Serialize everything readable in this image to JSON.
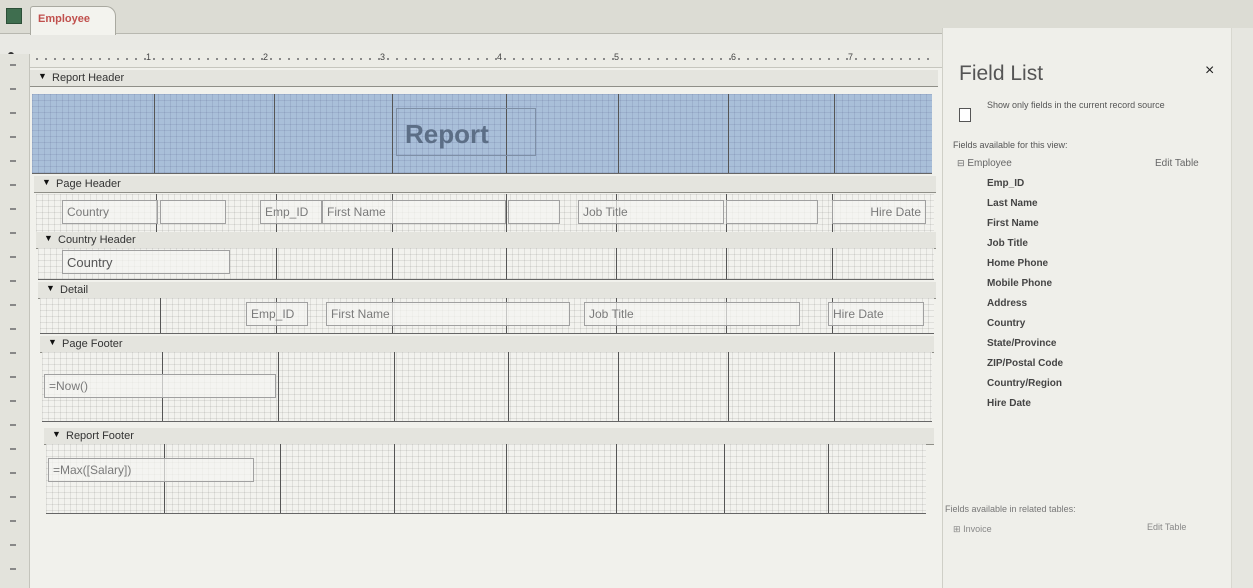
{
  "tab": {
    "label": "Employee"
  },
  "ruler": {
    "numbers": [
      "1",
      "2",
      "3",
      "4",
      "5",
      "6",
      "7"
    ]
  },
  "sections": {
    "report_header": "Report Header",
    "page_header": "Page Header",
    "country_header": "Country Header",
    "detail": "Detail",
    "page_footer": "Page Footer",
    "report_footer": "Report Footer"
  },
  "report_header": {
    "title": "Report"
  },
  "page_header": {
    "country": "Country",
    "emp_id": "Emp_ID",
    "first_name": "First Name",
    "job_title": "Job Title",
    "hire_date": "Hire Date"
  },
  "country_header": {
    "country": "Country"
  },
  "detail": {
    "emp_id": "Emp_ID",
    "first_name": "First Name",
    "job_title": "Job Title",
    "hire_date": "Hire Date"
  },
  "page_footer": {
    "expression": "=Now()"
  },
  "report_footer": {
    "expression": "=Max([Salary])"
  },
  "field_list": {
    "title": "Field List",
    "close": "×",
    "show_only_label": "Show only fields in the current record source",
    "available_label": "Fields available for this view:",
    "table_expander": "⊟",
    "table_name": "Employee",
    "edit_table": "Edit Table",
    "fields": [
      "Emp_ID",
      "Last Name",
      "First Name",
      "Job Title",
      "Home Phone",
      "Mobile Phone",
      "Address",
      "Country",
      "State/Province",
      "ZIP/Postal Code",
      "Country/Region",
      "Hire Date"
    ],
    "related_label": "Fields available in related tables:",
    "related_expander": "⊞",
    "related_table": "Invoice",
    "related_edit": "Edit Table"
  }
}
